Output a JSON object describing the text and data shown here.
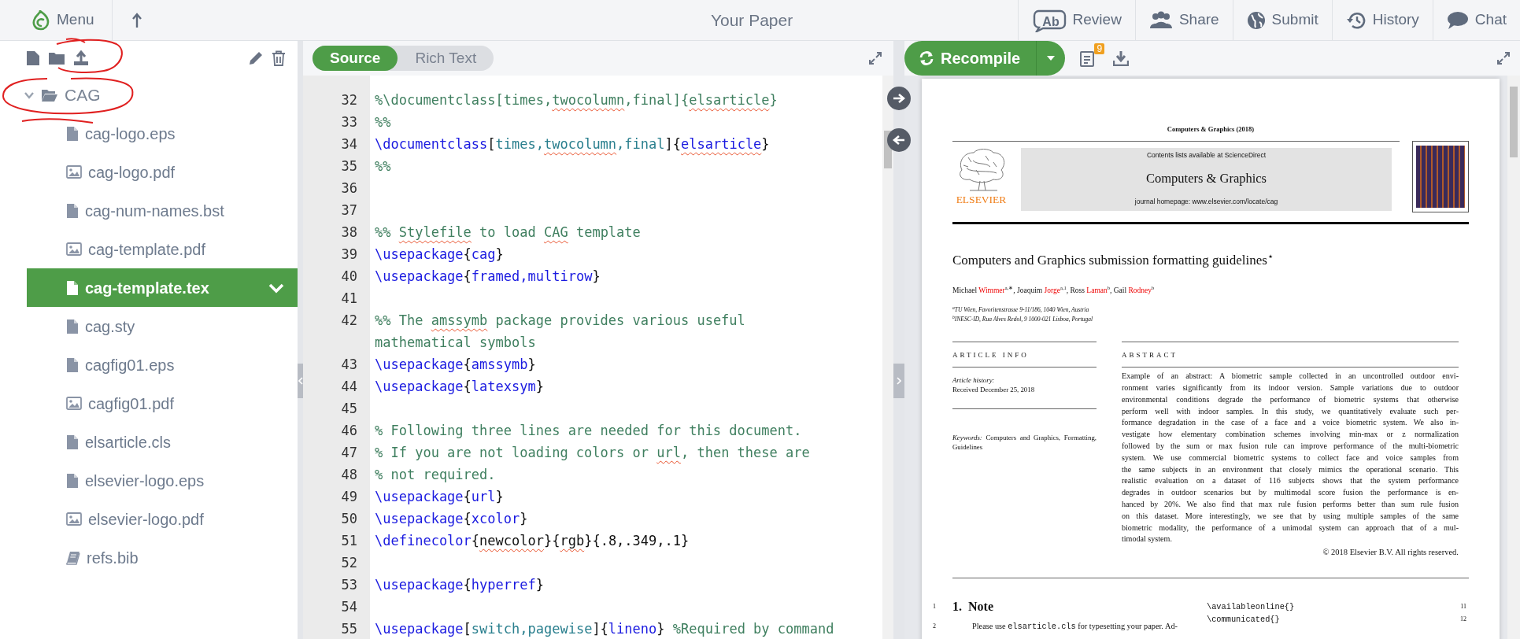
{
  "topbar": {
    "menu_label": "Menu",
    "title": "Your Paper",
    "actions": [
      {
        "label": "Review",
        "icon_text": "Ab"
      },
      {
        "label": "Share"
      },
      {
        "label": "Submit"
      },
      {
        "label": "History"
      },
      {
        "label": "Chat"
      }
    ]
  },
  "file_tree": {
    "folder": {
      "name": "CAG",
      "expanded": true
    },
    "files": [
      {
        "name": "cag-logo.eps",
        "kind": "file",
        "selected": false
      },
      {
        "name": "cag-logo.pdf",
        "kind": "image",
        "selected": false
      },
      {
        "name": "cag-num-names.bst",
        "kind": "file",
        "selected": false
      },
      {
        "name": "cag-template.pdf",
        "kind": "image",
        "selected": false
      },
      {
        "name": "cag-template.tex",
        "kind": "file",
        "selected": true
      },
      {
        "name": "cag.sty",
        "kind": "file",
        "selected": false
      },
      {
        "name": "cagfig01.eps",
        "kind": "file",
        "selected": false
      },
      {
        "name": "cagfig01.pdf",
        "kind": "image",
        "selected": false
      },
      {
        "name": "elsarticle.cls",
        "kind": "file",
        "selected": false
      },
      {
        "name": "elsevier-logo.eps",
        "kind": "file",
        "selected": false
      },
      {
        "name": "elsevier-logo.pdf",
        "kind": "image",
        "selected": false
      },
      {
        "name": "refs.bib",
        "kind": "bib",
        "selected": false
      }
    ]
  },
  "editor": {
    "modes": [
      {
        "label": "Source",
        "selected": true
      },
      {
        "label": "Rich Text",
        "selected": false
      }
    ],
    "lines": [
      {
        "number": "32",
        "segments": [
          {
            "kind": "comment",
            "text": "%\\documentclass[times,"
          },
          {
            "kind": "comment",
            "text": "twocolumn",
            "misspelled": true
          },
          {
            "kind": "comment",
            "text": ",final]{"
          },
          {
            "kind": "comment",
            "text": "elsarticle",
            "misspelled": true
          },
          {
            "kind": "comment",
            "text": "}"
          }
        ]
      },
      {
        "number": "33",
        "segments": [
          {
            "kind": "comment",
            "text": "%%"
          }
        ]
      },
      {
        "number": "34",
        "segments": [
          {
            "kind": "cmd",
            "text": "\\documentclass"
          },
          {
            "kind": "text",
            "text": "["
          },
          {
            "kind": "opt",
            "text": "times,"
          },
          {
            "kind": "opt",
            "text": "twocolumn",
            "misspelled": true
          },
          {
            "kind": "opt",
            "text": ",final"
          },
          {
            "kind": "text",
            "text": "]{"
          },
          {
            "kind": "cmd",
            "text": "elsarticle",
            "misspelled": true
          },
          {
            "kind": "text",
            "text": "}"
          }
        ]
      },
      {
        "number": "35",
        "segments": [
          {
            "kind": "comment",
            "text": "%%"
          }
        ]
      },
      {
        "number": "36"
      },
      {
        "number": "37"
      },
      {
        "number": "38",
        "segments": [
          {
            "kind": "comment",
            "text": "%% "
          },
          {
            "kind": "comment",
            "text": "Stylefile",
            "misspelled": true
          },
          {
            "kind": "comment",
            "text": " to load "
          },
          {
            "kind": "comment",
            "text": "CAG",
            "misspelled": true
          },
          {
            "kind": "comment",
            "text": " template"
          }
        ]
      },
      {
        "number": "39",
        "segments": [
          {
            "kind": "cmd",
            "text": "\\usepackage"
          },
          {
            "kind": "text",
            "text": "{"
          },
          {
            "kind": "cmd",
            "text": "cag"
          },
          {
            "kind": "text",
            "text": "}"
          }
        ]
      },
      {
        "number": "40",
        "segments": [
          {
            "kind": "cmd",
            "text": "\\usepackage"
          },
          {
            "kind": "text",
            "text": "{"
          },
          {
            "kind": "cmd",
            "text": "framed,multirow"
          },
          {
            "kind": "text",
            "text": "}"
          }
        ]
      },
      {
        "number": "41"
      },
      {
        "number": "42",
        "segments": [
          {
            "kind": "comment",
            "text": "%% The "
          },
          {
            "kind": "comment",
            "text": "amssymb",
            "misspelled": true
          },
          {
            "kind": "comment",
            "text": " package provides various useful mathematical symbols"
          }
        ]
      },
      {
        "number": "43",
        "segments": [
          {
            "kind": "cmd",
            "text": "\\usepackage"
          },
          {
            "kind": "text",
            "text": "{"
          },
          {
            "kind": "cmd",
            "text": "amssymb"
          },
          {
            "kind": "text",
            "text": "}"
          }
        ]
      },
      {
        "number": "44",
        "segments": [
          {
            "kind": "cmd",
            "text": "\\usepackage"
          },
          {
            "kind": "text",
            "text": "{"
          },
          {
            "kind": "cmd",
            "text": "latexsym"
          },
          {
            "kind": "text",
            "text": "}"
          }
        ]
      },
      {
        "number": "45"
      },
      {
        "number": "46",
        "segments": [
          {
            "kind": "comment",
            "text": "% Following three lines are needed for this document."
          }
        ]
      },
      {
        "number": "47",
        "segments": [
          {
            "kind": "comment",
            "text": "% If you are not loading colors or "
          },
          {
            "kind": "comment",
            "text": "url",
            "misspelled": true
          },
          {
            "kind": "comment",
            "text": ", then these are"
          }
        ]
      },
      {
        "number": "48",
        "segments": [
          {
            "kind": "comment",
            "text": "% not required."
          }
        ]
      },
      {
        "number": "49",
        "segments": [
          {
            "kind": "cmd",
            "text": "\\usepackage"
          },
          {
            "kind": "text",
            "text": "{"
          },
          {
            "kind": "cmd",
            "text": "url"
          },
          {
            "kind": "text",
            "text": "}"
          }
        ]
      },
      {
        "number": "50",
        "segments": [
          {
            "kind": "cmd",
            "text": "\\usepackage"
          },
          {
            "kind": "text",
            "text": "{"
          },
          {
            "kind": "cmd",
            "text": "xcolor"
          },
          {
            "kind": "text",
            "text": "}"
          }
        ]
      },
      {
        "number": "51",
        "segments": [
          {
            "kind": "cmd",
            "text": "\\definecolor"
          },
          {
            "kind": "text",
            "text": "{"
          },
          {
            "kind": "text",
            "text": "newcolor",
            "misspelled": true
          },
          {
            "kind": "text",
            "text": "}{"
          },
          {
            "kind": "text",
            "text": "rgb",
            "misspelled": true
          },
          {
            "kind": "text",
            "text": "}{.8,.349,.1}"
          }
        ]
      },
      {
        "number": "52"
      },
      {
        "number": "53",
        "segments": [
          {
            "kind": "cmd",
            "text": "\\usepackage"
          },
          {
            "kind": "text",
            "text": "{"
          },
          {
            "kind": "cmd",
            "text": "hyperref"
          },
          {
            "kind": "text",
            "text": "}"
          }
        ]
      },
      {
        "number": "54"
      },
      {
        "number": "55",
        "segments": [
          {
            "kind": "cmd",
            "text": "\\usepackage"
          },
          {
            "kind": "text",
            "text": "["
          },
          {
            "kind": "opt",
            "text": "switch,pagewise"
          },
          {
            "kind": "text",
            "text": "]{"
          },
          {
            "kind": "cmd",
            "text": "lineno"
          },
          {
            "kind": "text",
            "text": "} "
          },
          {
            "kind": "comment",
            "text": "%Required by command"
          }
        ]
      }
    ]
  },
  "pdf": {
    "recompile_label": "Recompile",
    "log_badge": "9",
    "page": {
      "running_head": "Computers & Graphics (2018)",
      "contents_line": "Contents lists available at ScienceDirect",
      "journal": "Computers & Graphics",
      "homepage": "journal homepage: www.elsevier.com/locate/cag",
      "publisher": "ELSEVIER",
      "title": "Computers and Graphics submission formatting guidelines$^{⋆}$",
      "authors": [
        {
          "given": "Michael",
          "surname": "Wimmer",
          "marks": "a,∗",
          "sep": ","
        },
        {
          "given": "Joaquim",
          "surname": "Jorge",
          "marks": "a,1",
          "sep": ","
        },
        {
          "given": "Ross",
          "surname": "Laman",
          "marks": "b",
          "sep": ","
        },
        {
          "given": "Gail",
          "surname": "Rodney",
          "marks": "b"
        }
      ],
      "affiliations": [
        "$^{a}$TU Wien, Favoritenstrasse 9-11/186, 1040 Wien, Austria",
        "$^{b}$INESC-ID, Rua Alves Redol, 9 1000-021 Lisboa, Portugal"
      ],
      "article_info_heading": "ARTICLE INFO",
      "history_label": "Article history:",
      "received": "Received December 25, 2018",
      "keywords": "*Keywords:* Computers and Graphics, Formatting, Guidelines",
      "abstract_heading": "ABSTRACT",
      "abstract_lines": [
        "Example of an abstract: A biometric sample collected in an uncontrolled outdoor envi-",
        "ronment varies significantly from its indoor version. Sample variations due to outdoor",
        "environmental conditions degrade the performance of biometric systems that otherwise",
        "perform well with indoor samples. In this study, we quantitatively evaluate such per-",
        "formance degradation in the case of a face and a voice biometric system. We also in-",
        "vestigate how elementary combination schemes involving min-max or z normalization",
        "followed by the sum or max fusion rule can improve performance of the multi-biometric",
        "system. We use commercial biometric systems to collect face and voice samples from",
        "the same subjects in an environment that closely mimics the operational scenario. This",
        "realistic evaluation on a dataset of 116 subjects shows that the system performance",
        "degrades in outdoor scenarios but by multimodal score fusion the performance is en-",
        "hanced by 20%. We also find that max rule fusion performs better than sum rule fusion",
        "on this dataset. More interestingly, we see that by using multiple samples of the same",
        "biometric modality, the performance of a unimodal system can approach that of a mul-",
        "timodal system."
      ],
      "copyright": "© 2018 Elsevier B.V. All rights reserved.",
      "left_lines": [
        {
          "number": "1",
          "heading": true,
          "segments": [
            {
              "kind": "bold",
              "text": "1.  Note"
            }
          ]
        },
        {
          "number": "2",
          "indent": true,
          "segments": [
            {
              "kind": "roman",
              "text": "Please use "
            },
            {
              "kind": "mono",
              "text": "elsarticle.cls"
            },
            {
              "kind": "roman",
              "text": " for typesetting your paper. Ad-"
            }
          ]
        }
      ],
      "right_lines": [
        {
          "number": "11",
          "segments": [
            {
              "kind": "mono",
              "text": "\\availableonline{}"
            }
          ]
        },
        {
          "number": "12",
          "segments": [
            {
              "kind": "mono",
              "text": "\\communicated{}"
            }
          ]
        }
      ]
    }
  }
}
